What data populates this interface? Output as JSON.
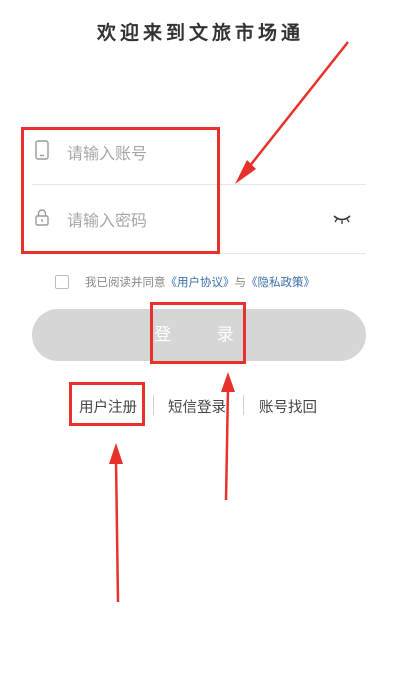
{
  "header": {
    "title": "欢迎来到文旅市场通"
  },
  "form": {
    "account_placeholder": "请输入账号",
    "password_placeholder": "请输入密码",
    "agree_prefix": "我已阅读并同意",
    "user_agreement": "《用户协议》",
    "and": "与",
    "privacy_policy": "《隐私政策》",
    "login_label": "登 录"
  },
  "links": {
    "register": "用户注册",
    "sms_login": "短信登录",
    "recover": "账号找回"
  },
  "colors": {
    "annotation_red": "#e8312a",
    "link_blue": "#3a6ea8",
    "button_disabled_gray": "#d6d6d6"
  },
  "icons": [
    "phone-icon",
    "lock-icon",
    "eye-closed-icon"
  ]
}
